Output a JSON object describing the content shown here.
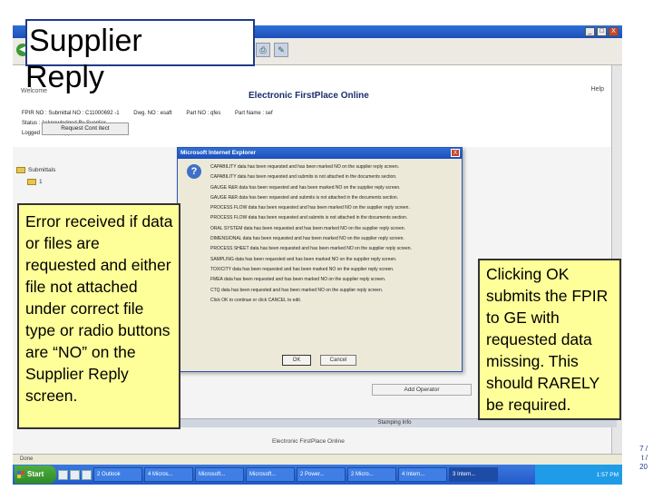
{
  "slide": {
    "title_line1": "Supplier",
    "title_line2": "Reply",
    "callout_left": "Error received if data or files are requested and either file not attached under correct file type or radio buttons are “NO” on the Supplier Reply screen.",
    "callout_right": "Clicking OK submits the FPIR to GE with requested data missing.  This should RARELY be required.",
    "page_num_lines": [
      "7 /",
      "t /",
      "20"
    ]
  },
  "browser": {
    "win_buttons": [
      "_",
      "□",
      "X"
    ],
    "status_text": "Done"
  },
  "app": {
    "welcome": "Welcome",
    "help": "Help",
    "title": "Electronic FirstPlace Online",
    "info_row1": [
      "FPIR NO : Submittal NO : C11000692 -1",
      "Dwg. NO : esaft",
      "Part NO : qfes",
      "Part Name : sef"
    ],
    "info_row2": "Status : Acknowledged By Supplier",
    "info_row3": "Logged In As : Supplier",
    "request_button": "Request Cont itect",
    "tree": {
      "items": [
        "Submittals",
        "1"
      ]
    },
    "add_operator": "Add Operator",
    "stamping": "Stamping Info",
    "footer_title": "Electronic FirstPlace Online"
  },
  "dialog": {
    "title": "Microsoft Internet Explorer",
    "close": "X",
    "lines": [
      "CAPABILITY data has been requested and has been marked NO on the supplier reply screen.",
      "CAPABILITY data has been requested and submits is not attached in the documents section.",
      "GAUGE R&R data has been requested and has been marked NO on the supplier reply screen.",
      "GAUGE R&R data has been requested and submits is not attached in the documents section.",
      "PROCESS FLOW data has been requested and has been marked NO on the supplier reply screen.",
      "PROCESS FLOW data has been requested and submits is not attached in the documents section.",
      "ORAL SYSTEM data has been requested and has been marked NO on the supplier reply screen.",
      "DIMENSIONAL data has been requested and has been marked NO on the supplier reply screen.",
      "PROCESS SHEET data has been requested and has been marked NO on the supplier reply screen.",
      "SAMPLING data has been requested and has been marked NO on the supplier reply screen.",
      "TOXICITY data has been requested and has been marked NO on the supplier reply screen.",
      "FMEA data has been requested and has been marked NO on the supplier reply screen.",
      "CTQ data has been requested and has been marked NO on the supplier reply screen.",
      "Click OK to continue or click CANCEL to edit."
    ],
    "ok": "OK",
    "cancel": "Cancel"
  },
  "taskbar": {
    "start": "Start",
    "items": [
      "2 Outlook",
      "4 Micros...",
      "Microsoft...",
      "Microsoft...",
      "2 Power...",
      "2 Micro...",
      "4 Intern...",
      "3 Intern..."
    ],
    "clock": "1:57 PM"
  }
}
